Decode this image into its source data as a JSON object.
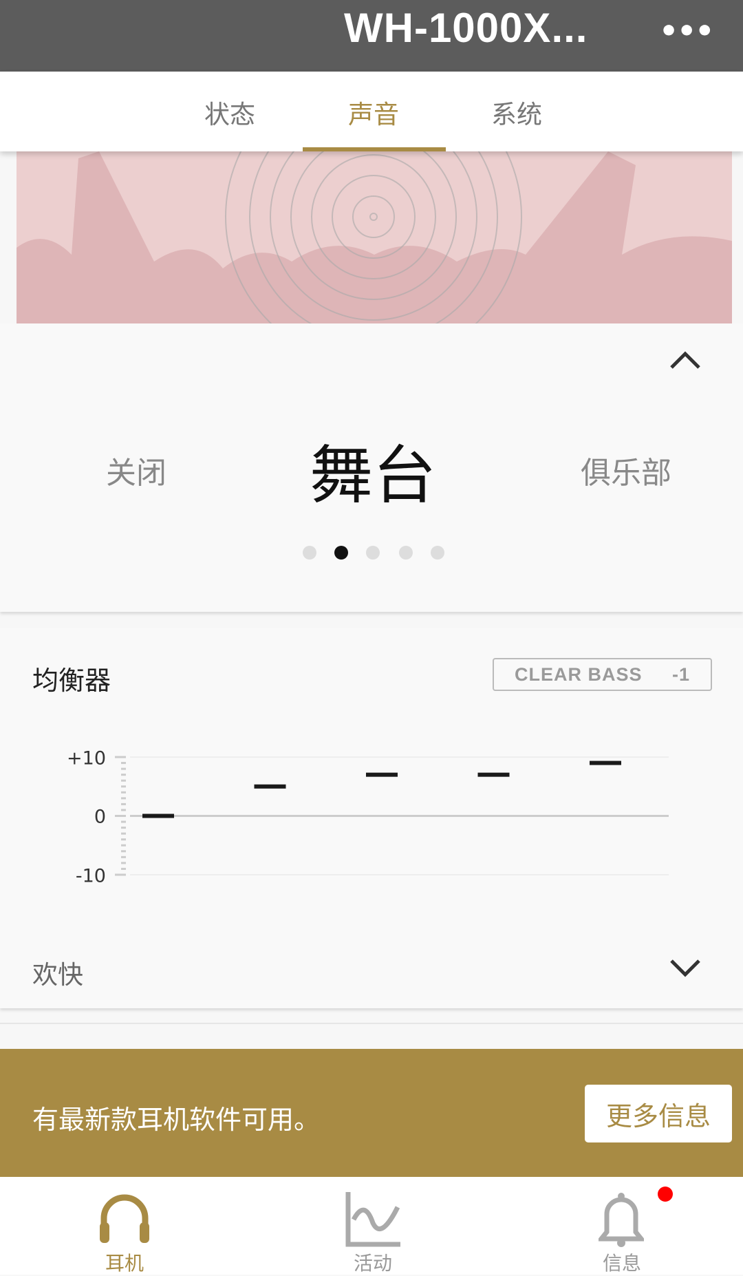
{
  "header": {
    "title": "WH-1000X...",
    "more_icon": "more-dots-icon"
  },
  "tabs": [
    {
      "label": "状态"
    },
    {
      "label": "声音",
      "active": true
    },
    {
      "label": "系统"
    }
  ],
  "sound_mode": {
    "prev": "关闭",
    "current": "舞台",
    "next": "俱乐部",
    "page_count": 5,
    "active_page": 2
  },
  "equalizer": {
    "title": "均衡器",
    "clear_bass_label": "CLEAR BASS",
    "clear_bass_value": "-1",
    "preset": "欢快",
    "chart_data": {
      "type": "bar",
      "y_ticks": [
        "+10",
        "0",
        "-10"
      ],
      "ylim": [
        -10,
        10
      ],
      "values": [
        0,
        5,
        7,
        7,
        9
      ]
    }
  },
  "update_banner": {
    "message": "有最新款耳机软件可用。",
    "button": "更多信息"
  },
  "bottom_nav": [
    {
      "label": "耳机",
      "icon": "headphones-icon",
      "active": true
    },
    {
      "label": "活动",
      "icon": "activity-chart-icon"
    },
    {
      "label": "信息",
      "icon": "bell-icon",
      "badge": true
    }
  ],
  "colors": {
    "accent": "#a88b44",
    "header": "#5c5c5c",
    "badge": "#ff0000"
  }
}
